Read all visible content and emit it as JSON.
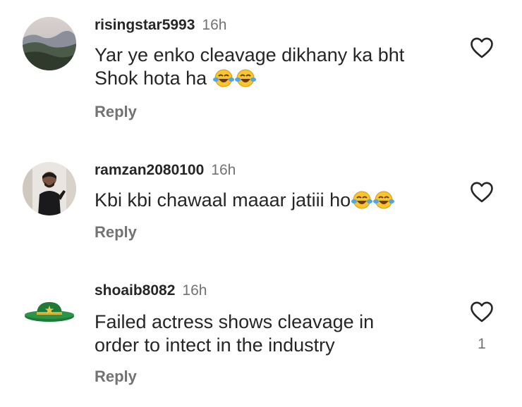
{
  "comments": [
    {
      "username": "risingstar5993",
      "time": "16h",
      "text_lines": [
        "Yar ye enko cleavage dikhany ka bht",
        "Shok hota ha"
      ],
      "emoji_count": 2,
      "emoji_icon": "face-with-tears-of-joy-icon",
      "reply_label": "Reply",
      "like_count": "",
      "avatar": "landscape-hills-photo"
    },
    {
      "username": "ramzan2080100",
      "time": "16h",
      "text_lines": [
        "Kbi kbi chawaal maaar jatiii ho"
      ],
      "emoji_count": 2,
      "emoji_icon": "face-with-tears-of-joy-icon",
      "reply_label": "Reply",
      "like_count": "",
      "avatar": "man-in-black-shirt-photo"
    },
    {
      "username": "shoaib8082",
      "time": "16h",
      "text_lines": [
        "Failed actress shows cleavage in",
        "order to intect in the industry"
      ],
      "emoji_count": 0,
      "reply_label": "Reply",
      "like_count": "1",
      "avatar": "green-cricket-hat-photo"
    }
  ],
  "colors": {
    "text": "#262626",
    "secondary": "#737373",
    "background": "#ffffff"
  },
  "icons": {
    "like": "heart-outline-icon"
  }
}
